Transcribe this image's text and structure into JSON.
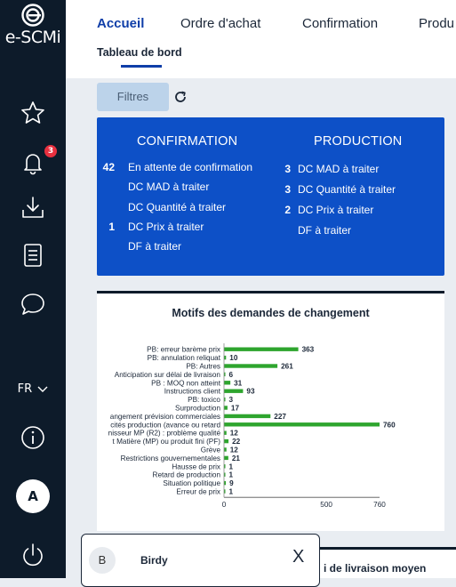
{
  "app": {
    "brand": "e-SCMi"
  },
  "sidebar": {
    "notification_count": "3",
    "language": "FR",
    "user_initial": "A"
  },
  "nav": {
    "tabs": [
      "Accueil",
      "Ordre d'achat",
      "Confirmation",
      "Produ"
    ],
    "active_tab": "Accueil",
    "subtab": "Tableau de bord"
  },
  "toolbar": {
    "filter_label": "Filtres"
  },
  "summary": {
    "confirmation": {
      "title": "CONFIRMATION",
      "rows": [
        {
          "count": "42",
          "label": "En attente de confirmation"
        },
        {
          "count": "",
          "label": "DC MAD à traiter"
        },
        {
          "count": "",
          "label": "DC Quantité à traiter"
        },
        {
          "count": "1",
          "label": "DC Prix à traiter"
        },
        {
          "count": "",
          "label": "DF à traiter"
        }
      ]
    },
    "production": {
      "title": "PRODUCTION",
      "rows": [
        {
          "count": "3",
          "label": "DC MAD à traiter"
        },
        {
          "count": "3",
          "label": "DC Quantité à traiter"
        },
        {
          "count": "2",
          "label": "DC Prix à traiter"
        },
        {
          "count": "",
          "label": "DF à traiter"
        }
      ]
    }
  },
  "chart_data": {
    "type": "bar",
    "orientation": "horizontal",
    "title": "Motifs des demandes de changement",
    "bar_color": "#2ea52e",
    "categories": [
      "PB: erreur barème prix",
      "PB: annulation reliquat",
      "PB: Autres",
      "Anticipation sur délai de livraison",
      "PB : MOQ non atteint",
      "Instructions client",
      "PB: toxico",
      "Surproduction",
      "angement prévision commerciales",
      "cités production (avance ou retard",
      "nisseur MP (R2) : problème qualité",
      "t Matière (MP) ou produit fini (PF)",
      "Grève",
      "Restrictions gouvernementales",
      "Hausse de prix",
      "Retard de production",
      "Situation politique",
      "Erreur de prix"
    ],
    "values": [
      363,
      10,
      261,
      6,
      31,
      93,
      3,
      17,
      227,
      760,
      12,
      22,
      12,
      21,
      1,
      1,
      9,
      1
    ],
    "x_ticks": [
      "0",
      "500",
      "760"
    ],
    "xlim": [
      0,
      760
    ]
  },
  "bottom_card": {
    "title_fragment": "i de livraison moyen"
  },
  "popup": {
    "initial": "B",
    "name": "Birdy",
    "close_label": "X"
  }
}
